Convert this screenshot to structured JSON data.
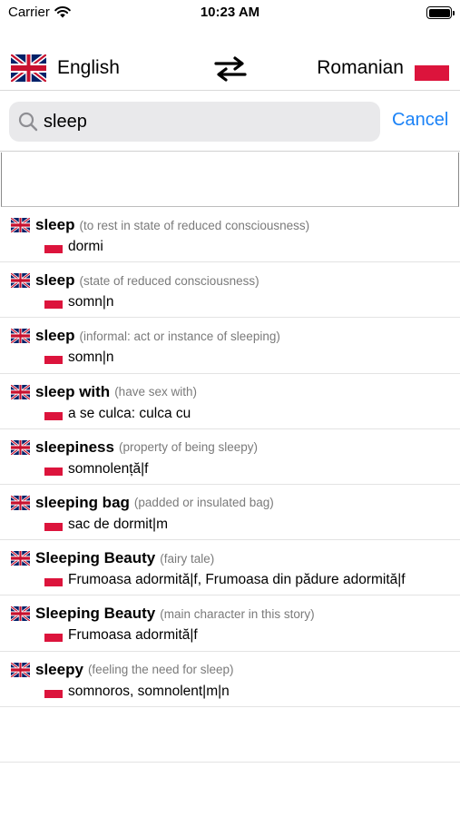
{
  "status_bar": {
    "carrier": "Carrier",
    "time": "10:23 AM"
  },
  "header": {
    "source_language": "English",
    "target_language": "Romanian",
    "source_flag": "uk-flag-icon",
    "target_flag": "romania-flag-icon",
    "swap_icon": "swap-arrows-icon"
  },
  "search": {
    "value": "sleep",
    "cancel_label": "Cancel"
  },
  "colors": {
    "accent": "#1a82f7",
    "flag_red": "#dc143c",
    "uk_blue": "#012169",
    "uk_red": "#c8102e",
    "gloss_gray": "#7a7a7a"
  },
  "results": [
    {
      "term": "sleep",
      "gloss": "(to rest in state of reduced consciousness)",
      "translation": "dormi"
    },
    {
      "term": "sleep",
      "gloss": "(state of reduced consciousness)",
      "translation": "somn|n"
    },
    {
      "term": "sleep",
      "gloss": "(informal: act or instance of sleeping)",
      "translation": "somn|n"
    },
    {
      "term": "sleep with",
      "gloss": "(have sex with)",
      "translation": "a se culca: culca cu"
    },
    {
      "term": "sleepiness",
      "gloss": "(property of being sleepy)",
      "translation": "somnolență|f"
    },
    {
      "term": "sleeping bag",
      "gloss": "(padded or insulated bag)",
      "translation": "sac de dormit|m"
    },
    {
      "term": "Sleeping Beauty",
      "gloss": "(fairy tale)",
      "translation": "Frumoasa adormită|f, Frumoasa din pădure adormită|f"
    },
    {
      "term": "Sleeping Beauty",
      "gloss": "(main character in this story)",
      "translation": "Frumoasa adormită|f"
    },
    {
      "term": "sleepy",
      "gloss": "(feeling the need for sleep)",
      "translation": "somnoros, somnolent|m|n"
    }
  ]
}
